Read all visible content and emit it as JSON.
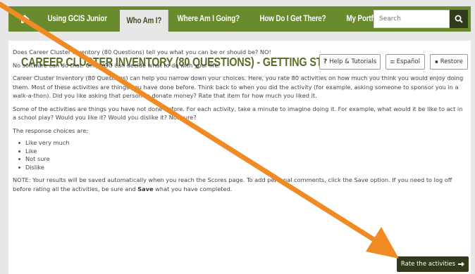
{
  "nav": {
    "items": [
      {
        "label": "Using GCIS Junior",
        "active": false
      },
      {
        "label": "Who Am I?",
        "active": true
      },
      {
        "label": "Where Am I Going?",
        "active": false
      },
      {
        "label": "How Do I Get There?",
        "active": false
      },
      {
        "label": "My Portfolio",
        "active": false
      }
    ],
    "search_placeholder": "Search"
  },
  "page": {
    "title": "CAREER CLUSTER INVENTORY (80 QUESTIONS) - GETTING STARTED",
    "buttons": {
      "help": "Help & Tutorials",
      "espanol": "Español",
      "restore": "Restore"
    },
    "paragraphs": [
      "Does Career Cluster Inventory (80 Questions) tell you what you can be or should be? NO!",
      "No software can do that. Only YOU can decide what to do with your life.",
      "Career Cluster Inventory (80 Questions) can help you narrow down your choices. Here, you rate 80 activities on how much you think you would enjoy doing them. Most of these activities are things you have done before. Think back to when you did the activity (for example, asking someone to sponsor you in a walk-a-thon). Did you like asking that person to donate money? Rate that item for how much you liked it.",
      "Some of the activities are things you have not done before. For each activity, take a minute to imagine doing it. For example, what would it be like to act in a school play? Would you like it? Would you dislike it? Not sure?",
      "The response choices are:"
    ],
    "choices": [
      "Like very much",
      "Like",
      "Not sure",
      "Dislike"
    ],
    "note_before_save": "NOTE: Your results will be saved automatically when you reach the Scores page. To add personal comments, click the Save option. If you need to log off before rating all the activities, be sure and ",
    "note_save": "Save",
    "note_after_save": " what you have completed.",
    "rate_button": "Rate the activities"
  },
  "colors": {
    "nav": "#6a8a2e",
    "title": "#5a6e28",
    "dark_button": "#2f3b1a",
    "arrow": "#f08a24"
  }
}
